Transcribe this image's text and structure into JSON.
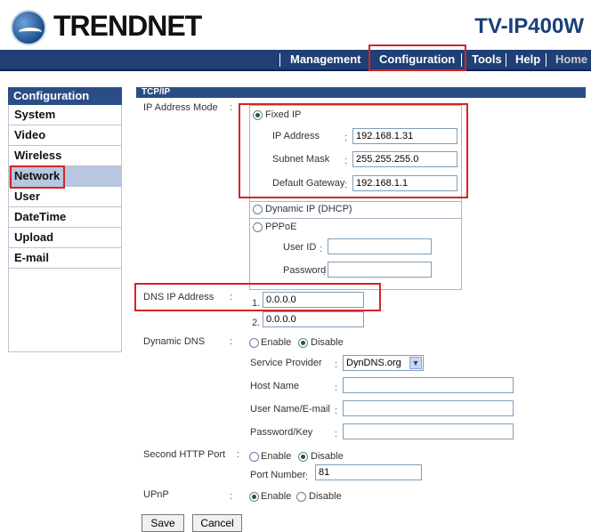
{
  "brand": {
    "logo_text": "TRENDNET",
    "model": "TV-IP400W"
  },
  "nav": {
    "items": [
      "Management",
      "Configuration",
      "Tools",
      "Help",
      "Home"
    ]
  },
  "sidebar": {
    "title": "Configuration",
    "items": [
      "System",
      "Video",
      "Wireless",
      "Network",
      "User",
      "DateTime",
      "Upload",
      "E-mail"
    ],
    "active": "Network"
  },
  "main": {
    "section_title": "TCP/IP",
    "ip_mode": {
      "label": "IP Address Mode",
      "fixed_label": "Fixed IP",
      "ip_address_label": "IP Address",
      "ip_address": "192.168.1.31",
      "subnet_label": "Subnet Mask",
      "subnet": "255.255.255.0",
      "gateway_label": "Default Gateway",
      "gateway": "192.168.1.1",
      "dhcp_label": "Dynamic IP (DHCP)",
      "pppoe_label": "PPPoE",
      "userid_label": "User ID",
      "password_label": "Password",
      "selected": "Fixed IP"
    },
    "dns": {
      "label": "DNS IP Address",
      "index1": "1.",
      "dns1": "0.0.0.0",
      "index2": "2.",
      "dns2": "0.0.0.0"
    },
    "ddns": {
      "label": "Dynamic DNS",
      "enable_label": "Enable",
      "disable_label": "Disable",
      "selected": "Disable",
      "provider_label": "Service Provider",
      "provider_value": "DynDNS.org",
      "host_label": "Host Name",
      "user_label": "User Name/E-mail",
      "pass_label": "Password/Key"
    },
    "second_http": {
      "label": "Second HTTP Port",
      "enable_label": "Enable",
      "disable_label": "Disable",
      "selected": "Disable",
      "port_label": "Port Number",
      "port_value": "81"
    },
    "upnp": {
      "label": "UPnP",
      "enable_label": "Enable",
      "disable_label": "Disable",
      "selected": "Enable"
    },
    "buttons": {
      "save": "Save",
      "cancel": "Cancel"
    }
  },
  "colors": {
    "nav_bg": "#1f3f75",
    "highlight": "#d42424",
    "header_bg": "#2b4d86"
  },
  "icons": {
    "logo": "trendnet-globe-icon",
    "dropdown": "chevron-down-icon"
  }
}
